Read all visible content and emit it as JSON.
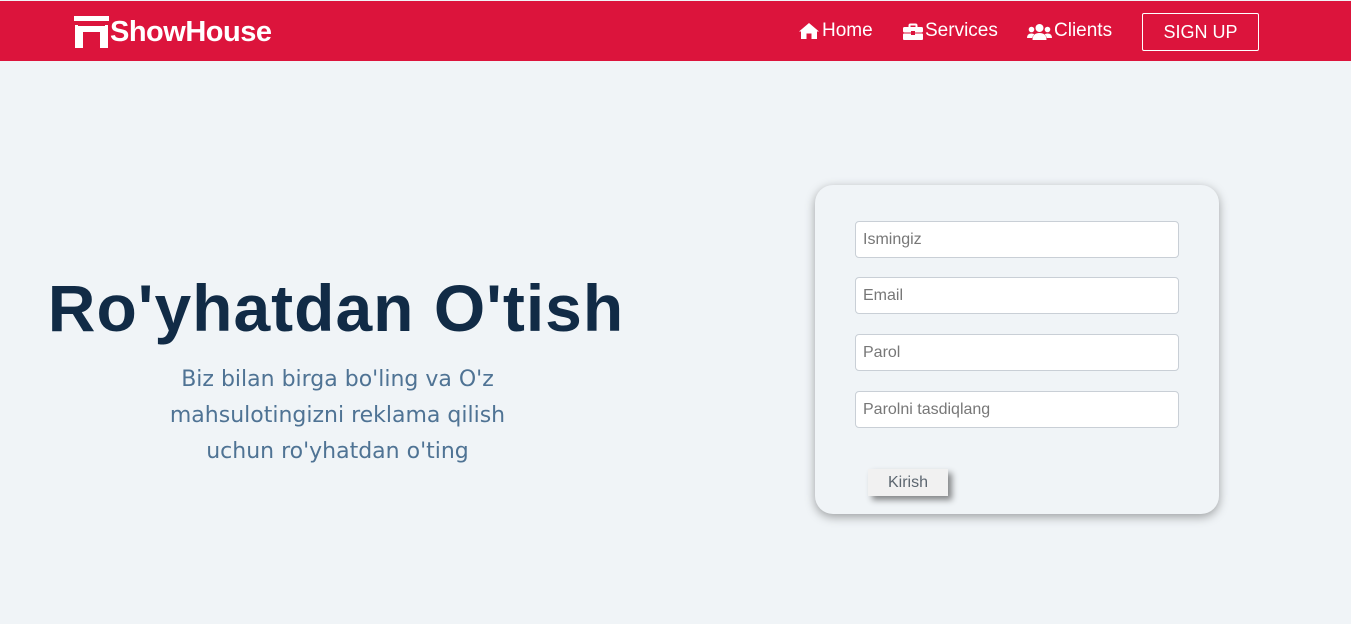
{
  "brand": {
    "name": "ShowHouse",
    "color": "#dc143c"
  },
  "nav": {
    "items": [
      {
        "label": "Home",
        "icon": "home-icon"
      },
      {
        "label": "Services",
        "icon": "briefcase-icon"
      },
      {
        "label": "Clients",
        "icon": "users-icon"
      }
    ],
    "signup_label": "SIGN UP"
  },
  "hero": {
    "title": "Ro'yhatdan O'tish",
    "subtitle_lines": [
      "Biz bilan birga bo'ling va O'z",
      "mahsulotingizni reklama qilish",
      "uchun ro'yhatdan o'ting"
    ]
  },
  "form": {
    "name_placeholder": "Ismingiz",
    "email_placeholder": "Email",
    "password_placeholder": "Parol",
    "confirm_placeholder": "Parolni tasdiqlang",
    "submit_label": "Kirish"
  },
  "colors": {
    "background": "#f0f4f7",
    "title": "#112b46",
    "subtitle": "#4f7394"
  }
}
